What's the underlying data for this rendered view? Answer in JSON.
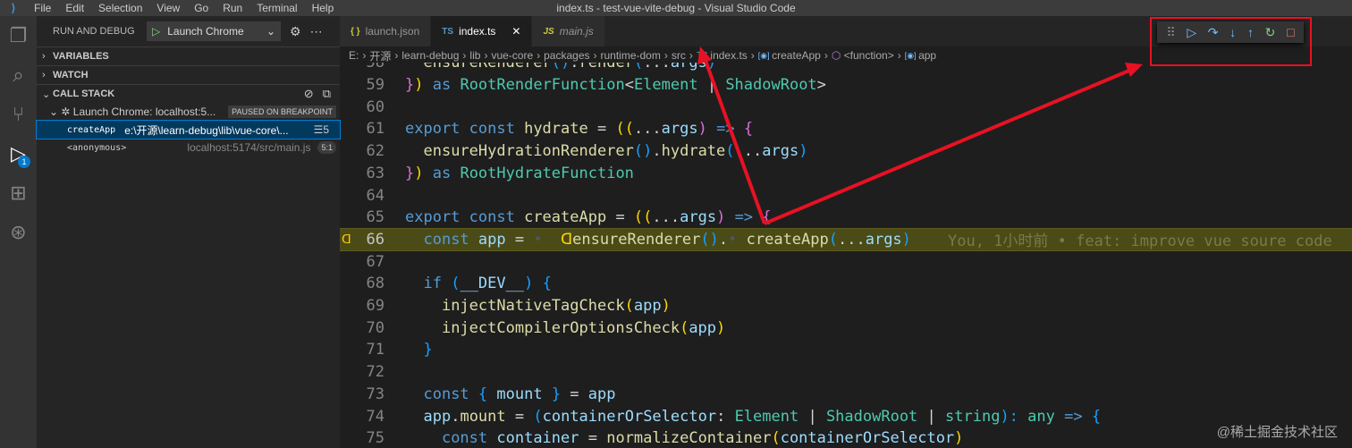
{
  "title_bar": {
    "title": "index.ts - test-vue-vite-debug - Visual Studio Code",
    "menu": [
      "File",
      "Edit",
      "Selection",
      "View",
      "Go",
      "Run",
      "Terminal",
      "Help"
    ]
  },
  "activity_bar": {
    "debug_badge": "1"
  },
  "sidebar": {
    "header": "RUN AND DEBUG",
    "config": "Launch Chrome",
    "sections": {
      "variables": "VARIABLES",
      "watch": "WATCH",
      "call_stack": "CALL STACK"
    },
    "session": {
      "name": "Launch Chrome: localhost:5...",
      "status": "PAUSED ON BREAKPOINT"
    },
    "frames": [
      {
        "name": "createApp",
        "source": "e:\\开源\\learn-debug\\lib\\vue-core\\...",
        "extra": "☰5"
      },
      {
        "name": "<anonymous>",
        "source": "localhost:5174/src/main.js",
        "extra": "5:1"
      }
    ]
  },
  "tabs": [
    {
      "icon": "{ }",
      "label": "launch.json"
    },
    {
      "icon": "TS",
      "label": "index.ts",
      "close": "✕"
    },
    {
      "icon": "JS",
      "label": "main.js"
    }
  ],
  "breadcrumb": [
    "E:",
    "开源",
    "learn-debug",
    "lib",
    "vue-core",
    "packages",
    "runtime-dom",
    "src",
    "index.ts",
    "createApp",
    "<function>",
    "app"
  ],
  "editor": {
    "blame": "You, 1小时前 • feat: improve vue soure code",
    "current_line": 66,
    "lines": [
      {
        "n": 58,
        "tokens": [
          [
            "  ",
            "p"
          ],
          [
            "ensureRenderer",
            "f"
          ],
          [
            "()",
            "b3"
          ],
          [
            ".",
            "p"
          ],
          [
            "render",
            "f"
          ],
          [
            "(",
            "b3"
          ],
          [
            "...",
            "p"
          ],
          [
            "args",
            "v"
          ],
          [
            ")",
            "b3"
          ]
        ]
      },
      {
        "n": 59,
        "tokens": [
          [
            "}",
            "b2"
          ],
          [
            ") ",
            "b1"
          ],
          [
            "as ",
            "k"
          ],
          [
            "RootRenderFunction",
            "t"
          ],
          [
            "<",
            "p"
          ],
          [
            "Element",
            "t"
          ],
          [
            " | ",
            "p"
          ],
          [
            "ShadowRoot",
            "t"
          ],
          [
            ">",
            "p"
          ]
        ]
      },
      {
        "n": 60,
        "tokens": []
      },
      {
        "n": 61,
        "tokens": [
          [
            "export ",
            "k"
          ],
          [
            "const ",
            "k"
          ],
          [
            "hydrate",
            "f"
          ],
          [
            " = ",
            "p"
          ],
          [
            "((",
            "b1"
          ],
          [
            "...",
            "p"
          ],
          [
            "args",
            "v"
          ],
          [
            ")",
            "b2"
          ],
          [
            " => ",
            "k"
          ],
          [
            "{",
            "b2"
          ]
        ]
      },
      {
        "n": 62,
        "tokens": [
          [
            "  ",
            "ws"
          ],
          [
            "ensureHydrationRenderer",
            "f"
          ],
          [
            "()",
            "b3"
          ],
          [
            ".",
            "p"
          ],
          [
            "hydrate",
            "f"
          ],
          [
            "(",
            "b3"
          ],
          [
            "...",
            "p"
          ],
          [
            "args",
            "v"
          ],
          [
            ")",
            "b3"
          ]
        ]
      },
      {
        "n": 63,
        "tokens": [
          [
            "}",
            "b2"
          ],
          [
            ") ",
            "b1"
          ],
          [
            "as ",
            "k"
          ],
          [
            "RootHydrateFunction",
            "t"
          ]
        ]
      },
      {
        "n": 64,
        "tokens": []
      },
      {
        "n": 65,
        "tokens": [
          [
            "export ",
            "k"
          ],
          [
            "const ",
            "k"
          ],
          [
            "createApp",
            "f"
          ],
          [
            " = ",
            "p"
          ],
          [
            "((",
            "b1"
          ],
          [
            "...",
            "p"
          ],
          [
            "args",
            "v"
          ],
          [
            ")",
            "b2"
          ],
          [
            " => ",
            "k"
          ],
          [
            "{",
            "b2"
          ]
        ]
      },
      {
        "n": 66,
        "tokens": [
          [
            "  ",
            "ws"
          ],
          [
            "const ",
            "k"
          ],
          [
            "app",
            "v"
          ],
          [
            " = ",
            "p"
          ],
          [
            "• ",
            "ws"
          ],
          [
            " ᗡ",
            "b1"
          ],
          [
            "ensureRenderer",
            "f"
          ],
          [
            "()",
            "b3"
          ],
          [
            ".",
            "p"
          ],
          [
            "• ",
            "ws"
          ],
          [
            "createApp",
            "f"
          ],
          [
            "(",
            "b3"
          ],
          [
            "...",
            "p"
          ],
          [
            "args",
            "v"
          ],
          [
            ")",
            "b3"
          ]
        ]
      },
      {
        "n": 67,
        "tokens": []
      },
      {
        "n": 68,
        "tokens": [
          [
            "  ",
            "ws"
          ],
          [
            "if ",
            "k"
          ],
          [
            "(",
            "b3"
          ],
          [
            "__DEV__",
            "v"
          ],
          [
            ") ",
            "b3"
          ],
          [
            "{",
            "b3"
          ]
        ]
      },
      {
        "n": 69,
        "tokens": [
          [
            "    ",
            "ws"
          ],
          [
            "injectNativeTagCheck",
            "f"
          ],
          [
            "(",
            "b1"
          ],
          [
            "app",
            "v"
          ],
          [
            ")",
            "b1"
          ]
        ]
      },
      {
        "n": 70,
        "tokens": [
          [
            "    ",
            "ws"
          ],
          [
            "injectCompilerOptionsCheck",
            "f"
          ],
          [
            "(",
            "b1"
          ],
          [
            "app",
            "v"
          ],
          [
            ")",
            "b1"
          ]
        ]
      },
      {
        "n": 71,
        "tokens": [
          [
            "  ",
            "ws"
          ],
          [
            "}",
            "b3"
          ]
        ]
      },
      {
        "n": 72,
        "tokens": []
      },
      {
        "n": 73,
        "tokens": [
          [
            "  ",
            "ws"
          ],
          [
            "const ",
            "k"
          ],
          [
            "{ ",
            "b3"
          ],
          [
            "mount",
            "v"
          ],
          [
            " } ",
            "b3"
          ],
          [
            "= ",
            "p"
          ],
          [
            "app",
            "v"
          ]
        ]
      },
      {
        "n": 74,
        "tokens": [
          [
            "  ",
            "ws"
          ],
          [
            "app",
            "v"
          ],
          [
            ".",
            "p"
          ],
          [
            "mount",
            "f"
          ],
          [
            " = ",
            "p"
          ],
          [
            "(",
            "b3"
          ],
          [
            "containerOrSelector",
            "v"
          ],
          [
            ": ",
            "p"
          ],
          [
            "Element",
            "t"
          ],
          [
            " | ",
            "p"
          ],
          [
            "ShadowRoot",
            "t"
          ],
          [
            " | ",
            "p"
          ],
          [
            "string",
            "t"
          ],
          [
            "): ",
            "b3"
          ],
          [
            "any ",
            "t"
          ],
          [
            "=> ",
            "k"
          ],
          [
            "{",
            "b3"
          ]
        ]
      },
      {
        "n": 75,
        "tokens": [
          [
            "    ",
            "ws"
          ],
          [
            "const ",
            "k"
          ],
          [
            "container",
            "v"
          ],
          [
            " = ",
            "p"
          ],
          [
            "normalizeContainer",
            "f"
          ],
          [
            "(",
            "b1"
          ],
          [
            "containerOrSelector",
            "v"
          ],
          [
            ")",
            "b1"
          ]
        ]
      }
    ]
  },
  "debug_toolbar": {
    "buttons": [
      {
        "name": "drag-handle",
        "glyph": "⠿",
        "color": "#888888"
      },
      {
        "name": "continue",
        "glyph": "▷",
        "color": "#75beff"
      },
      {
        "name": "step-over",
        "glyph": "↷",
        "color": "#75beff"
      },
      {
        "name": "step-into",
        "glyph": "↓",
        "color": "#75beff"
      },
      {
        "name": "step-out",
        "glyph": "↑",
        "color": "#75beff"
      },
      {
        "name": "restart",
        "glyph": "↻",
        "color": "#89d185"
      },
      {
        "name": "stop",
        "glyph": "□",
        "color": "#f48771"
      }
    ]
  },
  "annotation_color": "#e81123",
  "watermark": "@稀土掘金技术社区"
}
